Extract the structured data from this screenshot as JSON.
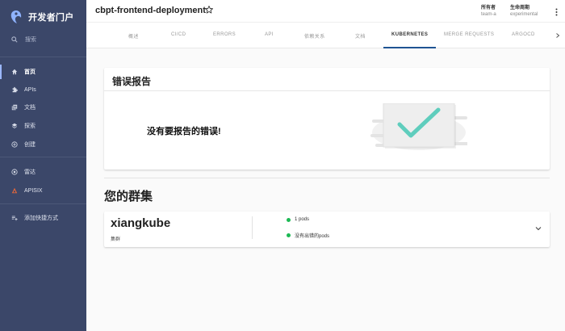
{
  "sidebar": {
    "app_name": "开发者门户",
    "search_label": "搜索",
    "items": [
      {
        "label": "首页",
        "icon": "home-icon",
        "active": true
      },
      {
        "label": "APIs",
        "icon": "extension-icon"
      },
      {
        "label": "文档",
        "icon": "docs-icon"
      },
      {
        "label": "探索",
        "icon": "layers-icon"
      },
      {
        "label": "创建",
        "icon": "add-circle-icon"
      },
      {
        "label": "雷达",
        "icon": "radar-icon"
      },
      {
        "label": "APISIX",
        "icon": "apisix-icon"
      },
      {
        "label": "添加快捷方式",
        "icon": "playlist-add-icon"
      }
    ]
  },
  "header": {
    "title": "cbpt-frontend-deployment",
    "owner_label": "所有者",
    "owner_value": "team-a",
    "lifecycle_label": "生命周期",
    "lifecycle_value": "experimental"
  },
  "tabs": [
    "概述",
    "CI/CD",
    "ERRORS",
    "API",
    "依赖关系",
    "文档",
    "KUBERNETES",
    "MERGE REQUESTS",
    "ARGOCD"
  ],
  "active_tab": "KUBERNETES",
  "errors": {
    "title": "错误报告",
    "empty_text": "没有要报告的错误!"
  },
  "clusters": {
    "title": "您的群集",
    "items": [
      {
        "name": "xiangkube",
        "type": "集群",
        "status": [
          "1 pods",
          "没有出错的pods"
        ]
      }
    ]
  },
  "colors": {
    "sidebar_bg": "#3b4769",
    "tab_underline": "#1f5493",
    "status_ok": "#1db954",
    "check": "#5fcdbd"
  }
}
